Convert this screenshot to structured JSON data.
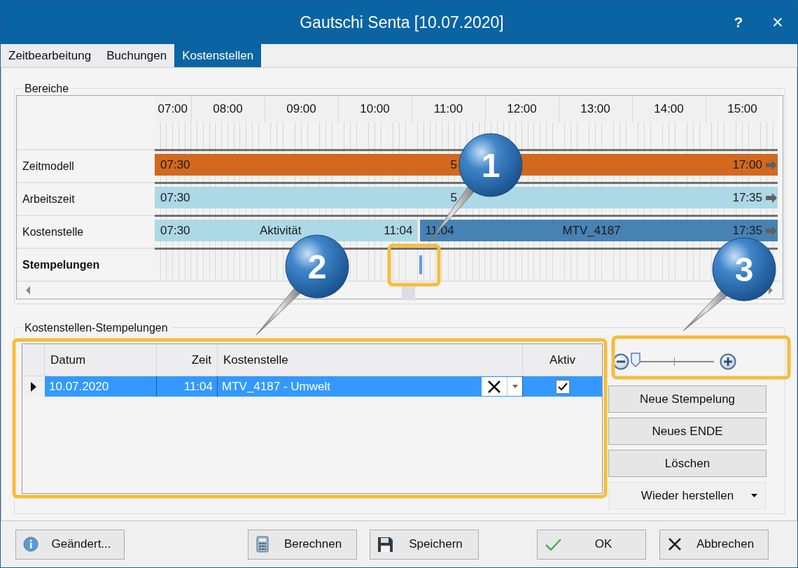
{
  "window": {
    "title": "Gautschi Senta [10.07.2020]",
    "buttons": [
      {
        "label": "?",
        "kind": "help"
      },
      {
        "label": "×",
        "kind": "close"
      }
    ]
  },
  "tabs": [
    {
      "label": "Zeitbearbeitung",
      "selected": false
    },
    {
      "label": "Buchungen",
      "selected": false
    },
    {
      "label": "Kostenstellen",
      "selected": true
    }
  ],
  "bereiche": {
    "title": "Bereiche",
    "hours": [
      "07:00",
      "08:00",
      "09:00",
      "10:00",
      "11:00",
      "12:00",
      "13:00",
      "14:00",
      "15:00"
    ],
    "rows": [
      {
        "label": "Zeitmodell",
        "kind": "bars",
        "segments": [
          {
            "start": "07:30",
            "middle": "5",
            "end": "17:00",
            "color": "#d2691e",
            "continues": true
          }
        ]
      },
      {
        "label": "Arbeitszeit",
        "kind": "bars",
        "segments": [
          {
            "start": "07:30",
            "middle": "5",
            "end": "17:35",
            "color": "#add8e6",
            "continues": true
          }
        ]
      },
      {
        "label": "Kostenstelle",
        "kind": "bars",
        "segments": [
          {
            "start": "07:30",
            "middle": "Aktivität",
            "end": "11:04",
            "color": "#add8e6",
            "continues": false
          },
          {
            "start": "11:04",
            "middle": "MTV_4187",
            "end": "17:35",
            "color": "#4682b4",
            "continues": true
          }
        ]
      },
      {
        "label": "Stempelungen",
        "kind": "stamps"
      }
    ]
  },
  "stempelungen": {
    "title": "Kostenstellen-Stempelungen",
    "columns": [
      "Datum",
      "Zeit",
      "Kostenstelle",
      "Aktiv"
    ],
    "rows": [
      {
        "datum": "10.07.2020",
        "zeit": "11:04",
        "kostenstelle": "MTV_4187 - Umwelt",
        "aktiv": true,
        "selected": true
      }
    ]
  },
  "zoom": {
    "level": 0
  },
  "side_buttons": [
    {
      "label": "Neue Stempelung",
      "kind": "button"
    },
    {
      "label": "Neues ENDE",
      "kind": "button"
    },
    {
      "label": "Löschen",
      "kind": "button"
    },
    {
      "label": "Wieder herstellen",
      "kind": "split"
    }
  ],
  "footer": [
    {
      "label": "Geändert...",
      "kind": "info"
    },
    {
      "label": "Berechnen",
      "kind": "calculator"
    },
    {
      "label": "Speichern",
      "kind": "save"
    },
    {
      "label": "OK",
      "kind": "ok"
    },
    {
      "label": "Abbrechen",
      "kind": "cancel"
    }
  ],
  "callouts": [
    {
      "number": "1"
    },
    {
      "number": "2"
    },
    {
      "number": "3"
    }
  ]
}
